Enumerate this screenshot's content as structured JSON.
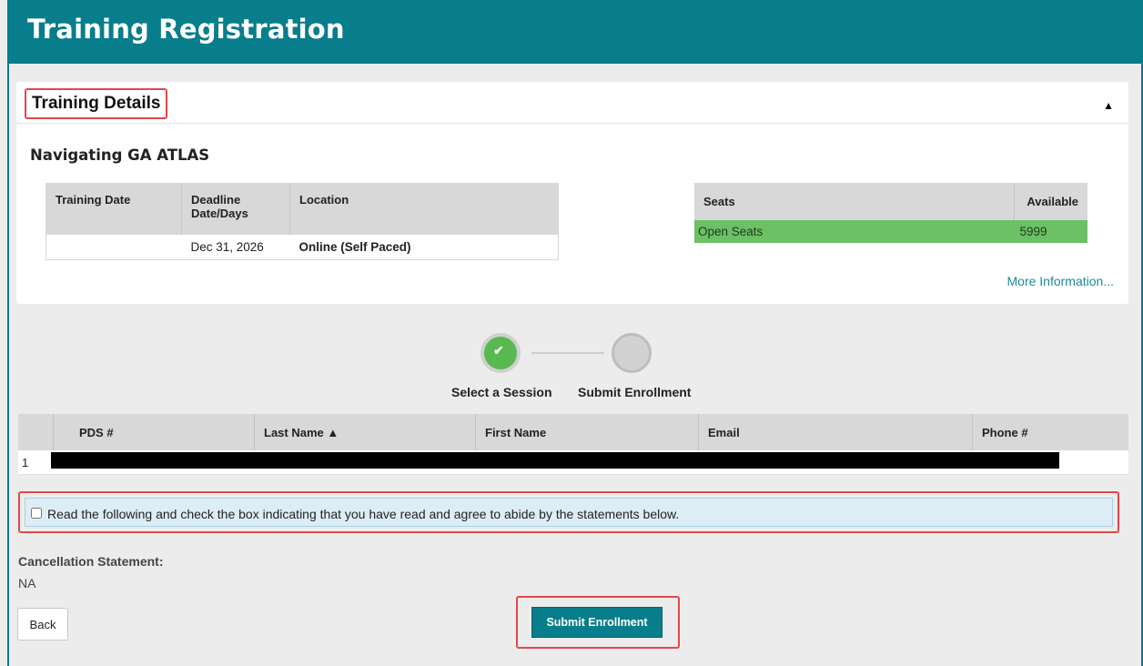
{
  "header": {
    "title": "Training Registration"
  },
  "panel": {
    "title": "Training Details",
    "collapse_icon": "caret-up-icon",
    "course_title": "Navigating GA ATLAS",
    "sessions_table": {
      "columns": [
        "Training Date",
        "Deadline Date/Days",
        "Location"
      ],
      "rows": [
        [
          "",
          "Dec 31, 2026",
          "Online (Self Paced)"
        ]
      ]
    },
    "seats_table": {
      "columns": [
        "Seats",
        "Available"
      ],
      "rows": [
        [
          "Open Seats",
          "5999"
        ]
      ],
      "row_color": "#6cc065"
    },
    "more_info_link": "More Information..."
  },
  "stepper": {
    "steps": [
      {
        "label": "Select a Session",
        "state": "complete",
        "icon": "check-icon"
      },
      {
        "label": "Submit Enrollment",
        "state": "pending"
      }
    ]
  },
  "participants": {
    "columns": [
      "",
      "PDS #",
      "Last Name ▲",
      "First Name",
      "Email",
      "Phone #"
    ],
    "rows": [
      {
        "index": "1"
      }
    ]
  },
  "agreement": {
    "text": "Read the following and check the box indicating that you have read and agree to abide by the statements below.",
    "checked": false
  },
  "cancellation": {
    "label": "Cancellation Statement:",
    "value": "NA"
  },
  "buttons": {
    "back": "Back",
    "submit": "Submit Enrollment"
  },
  "colors": {
    "brand": "#087d8b",
    "highlight": "#e0474c",
    "success": "#59b84f"
  }
}
